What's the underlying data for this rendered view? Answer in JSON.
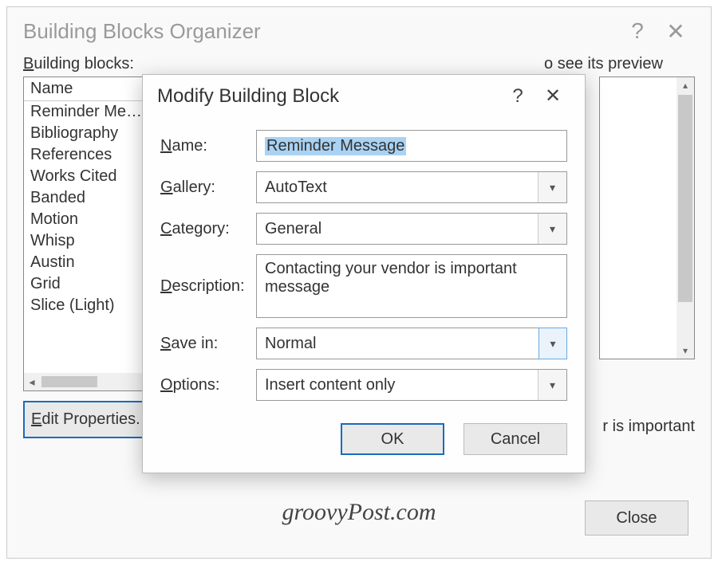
{
  "outer": {
    "title": "Building Blocks Organizer",
    "help_icon": "?",
    "close_icon": "✕",
    "blocks_label": "Building blocks:",
    "preview_hint": "o see its preview",
    "list_header": "Name",
    "items": [
      "Reminder Me…",
      "Bibliography",
      "References",
      "Works Cited",
      "Banded",
      "Motion",
      "Whisp",
      "Austin",
      "Grid",
      "Slice (Light)"
    ],
    "preview_caption": "r is important",
    "edit_props_label": "Edit Properties.",
    "close_label": "Close"
  },
  "modal": {
    "title": "Modify Building Block",
    "help_icon": "?",
    "close_icon": "✕",
    "labels": {
      "name": "Name:",
      "gallery": "Gallery:",
      "category": "Category:",
      "description": "Description:",
      "save_in": "Save in:",
      "options": "Options:"
    },
    "values": {
      "name": "Reminder Message",
      "gallery": "AutoText",
      "category": "General",
      "description": "Contacting your vendor is important message",
      "save_in": "Normal",
      "options": "Insert content only"
    },
    "ok_label": "OK",
    "cancel_label": "Cancel"
  },
  "watermark": "groovyPost.com"
}
